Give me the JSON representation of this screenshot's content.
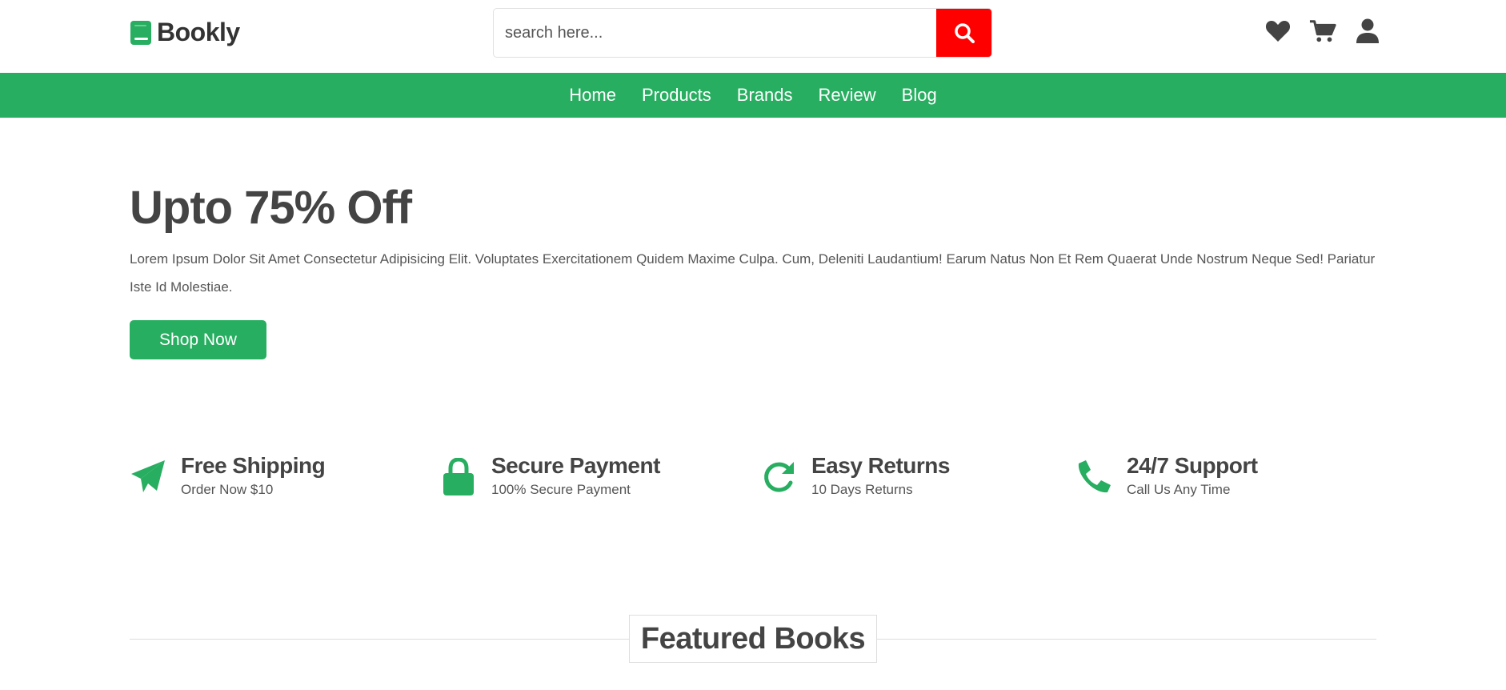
{
  "brand": {
    "name": "Bookly",
    "icon": "book-icon"
  },
  "search": {
    "placeholder": "search here...",
    "icon": "search-icon"
  },
  "header_icons": [
    "heart-icon",
    "cart-icon",
    "user-icon"
  ],
  "nav": {
    "items": [
      "Home",
      "Products",
      "Brands",
      "Review",
      "Blog"
    ]
  },
  "hero": {
    "title": "Upto 75% Off",
    "description": "Lorem Ipsum Dolor Sit Amet Consectetur Adipisicing Elit. Voluptates Exercitationem Quidem Maxime Culpa. Cum, Deleniti Laudantium! Earum Natus Non Et Rem Quaerat Unde Nostrum Neque Sed! Pariatur Iste Id Molestiae.",
    "button": "Shop Now"
  },
  "features": [
    {
      "icon": "paper-plane-icon",
      "title": "Free Shipping",
      "subtitle": "Order Now $10"
    },
    {
      "icon": "lock-icon",
      "title": "Secure Payment",
      "subtitle": "100% Secure Payment"
    },
    {
      "icon": "redo-icon",
      "title": "Easy Returns",
      "subtitle": "10 Days Returns"
    },
    {
      "icon": "phone-icon",
      "title": "24/7 Support",
      "subtitle": "Call Us Any Time"
    }
  ],
  "section": {
    "title": "Featured Books"
  },
  "colors": {
    "accent": "#27ae60",
    "search_button": "#ff0000",
    "text": "#444444"
  }
}
